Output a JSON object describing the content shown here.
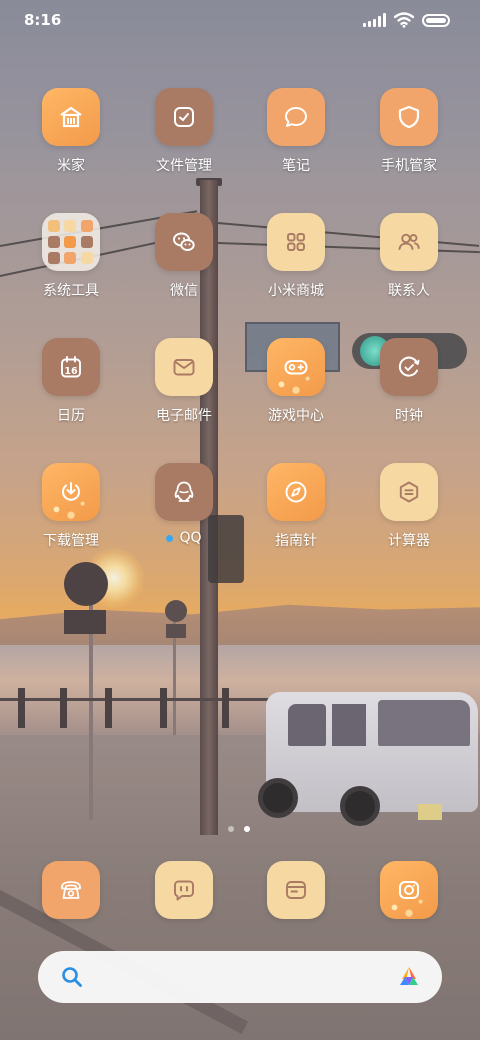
{
  "status_bar": {
    "time": "8:16",
    "icons": [
      "signal-icon",
      "wifi-icon",
      "battery-icon"
    ]
  },
  "apps": [
    {
      "id": "mijia",
      "label": "米家",
      "icon": "home-icon",
      "style": "orange"
    },
    {
      "id": "file-manager",
      "label": "文件管理",
      "icon": "folder-check-icon",
      "style": "brown"
    },
    {
      "id": "notes",
      "label": "笔记",
      "icon": "chat-bubble-icon",
      "style": "salmon"
    },
    {
      "id": "security",
      "label": "手机管家",
      "icon": "shield-icon",
      "style": "salmon"
    },
    {
      "id": "system-tools",
      "label": "系统工具",
      "icon": "folder-grid-icon",
      "style": "folder"
    },
    {
      "id": "wechat",
      "label": "微信",
      "icon": "wechat-icon",
      "style": "brown"
    },
    {
      "id": "mi-store",
      "label": "小米商城",
      "icon": "grid-squares-icon",
      "style": "cream"
    },
    {
      "id": "contacts",
      "label": "联系人",
      "icon": "people-icon",
      "style": "cream"
    },
    {
      "id": "calendar",
      "label": "日历",
      "icon": "calendar-icon",
      "style": "brown",
      "badge_text": "16"
    },
    {
      "id": "email",
      "label": "电子邮件",
      "icon": "mail-icon",
      "style": "cream"
    },
    {
      "id": "game-center",
      "label": "游戏中心",
      "icon": "gamepad-icon",
      "style": "orange-sparkle"
    },
    {
      "id": "clock",
      "label": "时钟",
      "icon": "clock-icon",
      "style": "brown"
    },
    {
      "id": "downloads",
      "label": "下载管理",
      "icon": "download-icon",
      "style": "orange-sparkle"
    },
    {
      "id": "qq",
      "label": "QQ",
      "icon": "qq-penguin-icon",
      "style": "brown",
      "has_dot": true
    },
    {
      "id": "compass",
      "label": "指南针",
      "icon": "compass-icon",
      "style": "orange"
    },
    {
      "id": "calculator",
      "label": "计算器",
      "icon": "calculator-icon",
      "style": "cream"
    }
  ],
  "page_indicator": {
    "pages": 2,
    "active": 2
  },
  "dock": [
    {
      "id": "phone",
      "icon": "phone-icon",
      "style": "salmon"
    },
    {
      "id": "messages",
      "icon": "message-icon",
      "style": "cream"
    },
    {
      "id": "browser",
      "icon": "browser-icon",
      "style": "cream"
    },
    {
      "id": "camera",
      "icon": "camera-icon",
      "style": "orange-sparkle"
    }
  ],
  "search": {
    "icon": "search-icon",
    "assistant_icon": "xiaoai-icon",
    "accent_color": "#2a8fe0"
  },
  "colors": {
    "orange": "#f29a4a",
    "salmon": "#f1a56a",
    "brown": "#a97a64",
    "cream": "#f6d8a2"
  }
}
